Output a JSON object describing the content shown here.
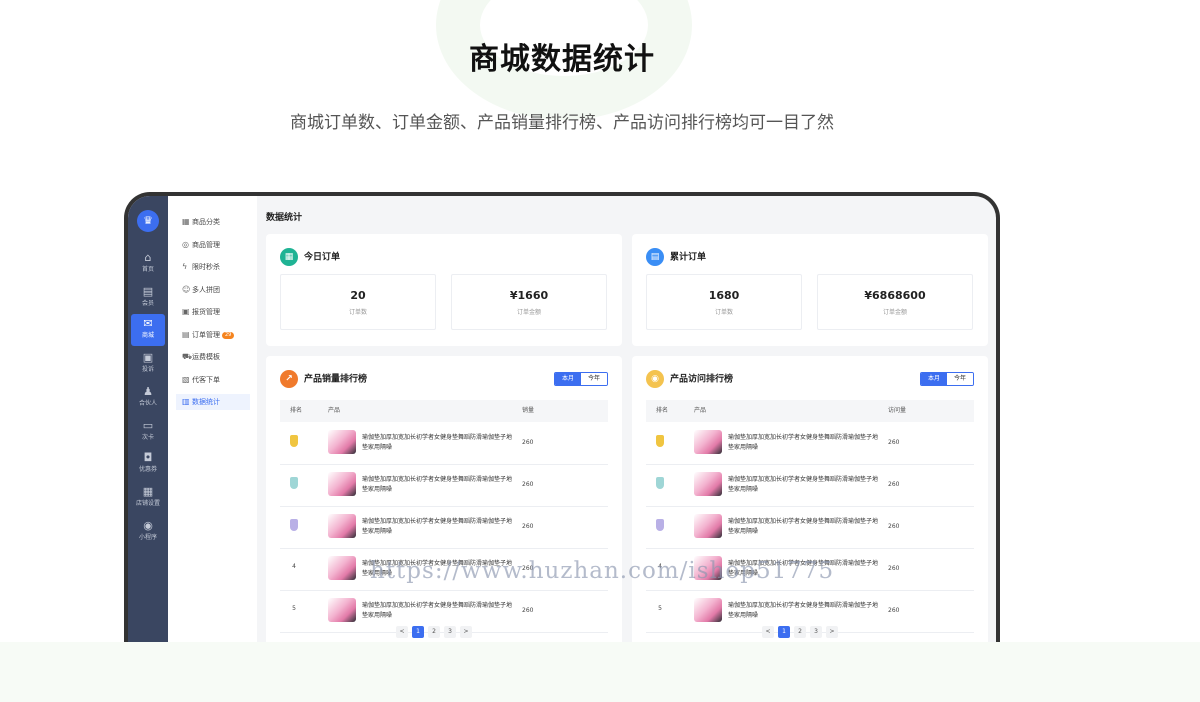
{
  "hero": {
    "title": "商城数据统计",
    "subtitle": "商城订单数、订单金额、产品销量排行榜、产品访问排行榜均可一目了然"
  },
  "rail": {
    "items": [
      {
        "label": "首页",
        "icon": "home-icon"
      },
      {
        "label": "会员",
        "icon": "member-card-icon"
      },
      {
        "label": "商城",
        "icon": "mall-icon"
      },
      {
        "label": "投诉",
        "icon": "gallery-icon"
      },
      {
        "label": "合伙人",
        "icon": "partner-icon"
      },
      {
        "label": "次卡",
        "icon": "card-icon"
      },
      {
        "label": "优惠券",
        "icon": "coupon-icon"
      },
      {
        "label": "店铺设置",
        "icon": "store-icon"
      },
      {
        "label": "小程序",
        "icon": "mini-program-icon"
      }
    ]
  },
  "subnav": {
    "items": [
      {
        "label": "商品分类",
        "icon": "grid-icon"
      },
      {
        "label": "商品管理",
        "icon": "box-icon"
      },
      {
        "label": "限时秒杀",
        "icon": "lightning-icon"
      },
      {
        "label": "多人拼团",
        "icon": "group-icon"
      },
      {
        "label": "报货管理",
        "icon": "cart-icon"
      },
      {
        "label": "订单管理",
        "icon": "order-icon",
        "badge": "29"
      },
      {
        "label": "运费模板",
        "icon": "truck-icon"
      },
      {
        "label": "代客下单",
        "icon": "clipboard-icon"
      },
      {
        "label": "数据统计",
        "icon": "bar-chart-icon"
      }
    ]
  },
  "main": {
    "title": "数据统计"
  },
  "today": {
    "title": "今日订单",
    "orders": {
      "value": "20",
      "label": "订单数"
    },
    "amount": {
      "value": "¥1660",
      "label": "订单金额"
    }
  },
  "total": {
    "title": "累计订单",
    "orders": {
      "value": "1680",
      "label": "订单数"
    },
    "amount": {
      "value": "¥6868600",
      "label": "订单金额"
    }
  },
  "sales_rank": {
    "title": "产品销量排行榜",
    "tabs": [
      "本月",
      "今年"
    ],
    "columns": [
      "排名",
      "产品",
      "销量"
    ]
  },
  "visit_rank": {
    "title": "产品访问排行榜",
    "tabs": [
      "本月",
      "今年"
    ],
    "columns": [
      "排名",
      "产品",
      "访问量"
    ]
  },
  "product_name": "瑜伽垫加厚加宽加长初学者女健身垫舞蹈防滑瑜伽垫子地垫家用隔噪",
  "ranks": [
    "1",
    "2",
    "3",
    "4",
    "5"
  ],
  "row_value": "260",
  "pager": [
    "<",
    "1",
    "2",
    "3",
    ">"
  ],
  "watermark": "https://www.huzhan.com/ishop51775",
  "colors": {
    "accent": "#3c6ef0",
    "rail_bg": "#3a4661",
    "today_icon": "#1fb394",
    "total_icon": "#3a8ef5",
    "sales_icon": "#f07a2c",
    "visit_icon": "#f4c34f",
    "gold": "#f0c540",
    "silver": "#9fd6d6",
    "bronze": "#b9b0e6"
  }
}
